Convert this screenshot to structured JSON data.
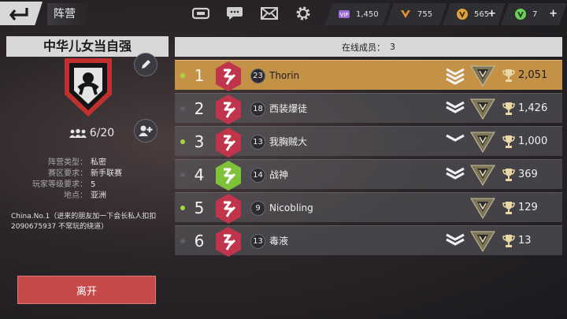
{
  "header": {
    "title": "阵营"
  },
  "resources": [
    {
      "icon": "vip-gem-icon",
      "value": "1,450",
      "color": "#9b6bd6",
      "has_plus": false
    },
    {
      "icon": "honor-chevron-icon",
      "value": "755",
      "color": "#e88f2c",
      "has_plus": false
    },
    {
      "icon": "silver-coin-icon",
      "value": "565",
      "color": "#e0a33a",
      "has_plus": true
    },
    {
      "icon": "gold-gem-icon",
      "value": "7",
      "color": "#6bd15a",
      "has_plus": true
    }
  ],
  "clan": {
    "name": "中华儿女当自强",
    "members": "6/20",
    "info": [
      {
        "key": "阵营类型：",
        "value": "私密"
      },
      {
        "key": "赛区要求：",
        "value": "新手联赛"
      },
      {
        "key": "玩家等级要求：",
        "value": "5"
      },
      {
        "key": "地点：",
        "value": "亚洲"
      }
    ],
    "description": "China.No.1（进来的朋友加一下会长私人扣扣2090675937 不常玩的绕道）",
    "leave_label": "离开"
  },
  "online": {
    "label": "在线成员：",
    "count": "3"
  },
  "member_list": [
    {
      "rank": "1",
      "level": "23",
      "name": "Thorin",
      "trophies": "2,051",
      "online": true,
      "self": true,
      "chevron": "3-chevron",
      "avatar_color": "#c0344c"
    },
    {
      "rank": "2",
      "level": "18",
      "name": "西装爆徒",
      "trophies": "1,426",
      "online": false,
      "self": false,
      "chevron": "2-chevron",
      "avatar_color": "#c0344c"
    },
    {
      "rank": "3",
      "level": "13",
      "name": "我胸贼大",
      "trophies": "1,000",
      "online": true,
      "self": false,
      "chevron": "1-chevron",
      "avatar_color": "#c0344c"
    },
    {
      "rank": "4",
      "level": "14",
      "name": "战神",
      "trophies": "369",
      "online": false,
      "self": false,
      "chevron": "2-chevron",
      "avatar_color": "#7ec23a"
    },
    {
      "rank": "5",
      "level": "9",
      "name": "Nicobling",
      "trophies": "129",
      "online": true,
      "self": false,
      "chevron": "none",
      "avatar_color": "#c0344c"
    },
    {
      "rank": "6",
      "level": "13",
      "name": "毒液",
      "trophies": "13",
      "online": false,
      "self": false,
      "chevron": "2-chevron",
      "avatar_color": "#c0344c"
    }
  ],
  "colors": {
    "accent_gold": "#c39246",
    "leave_red": "#c54a48",
    "online_green": "#a8d63a"
  }
}
